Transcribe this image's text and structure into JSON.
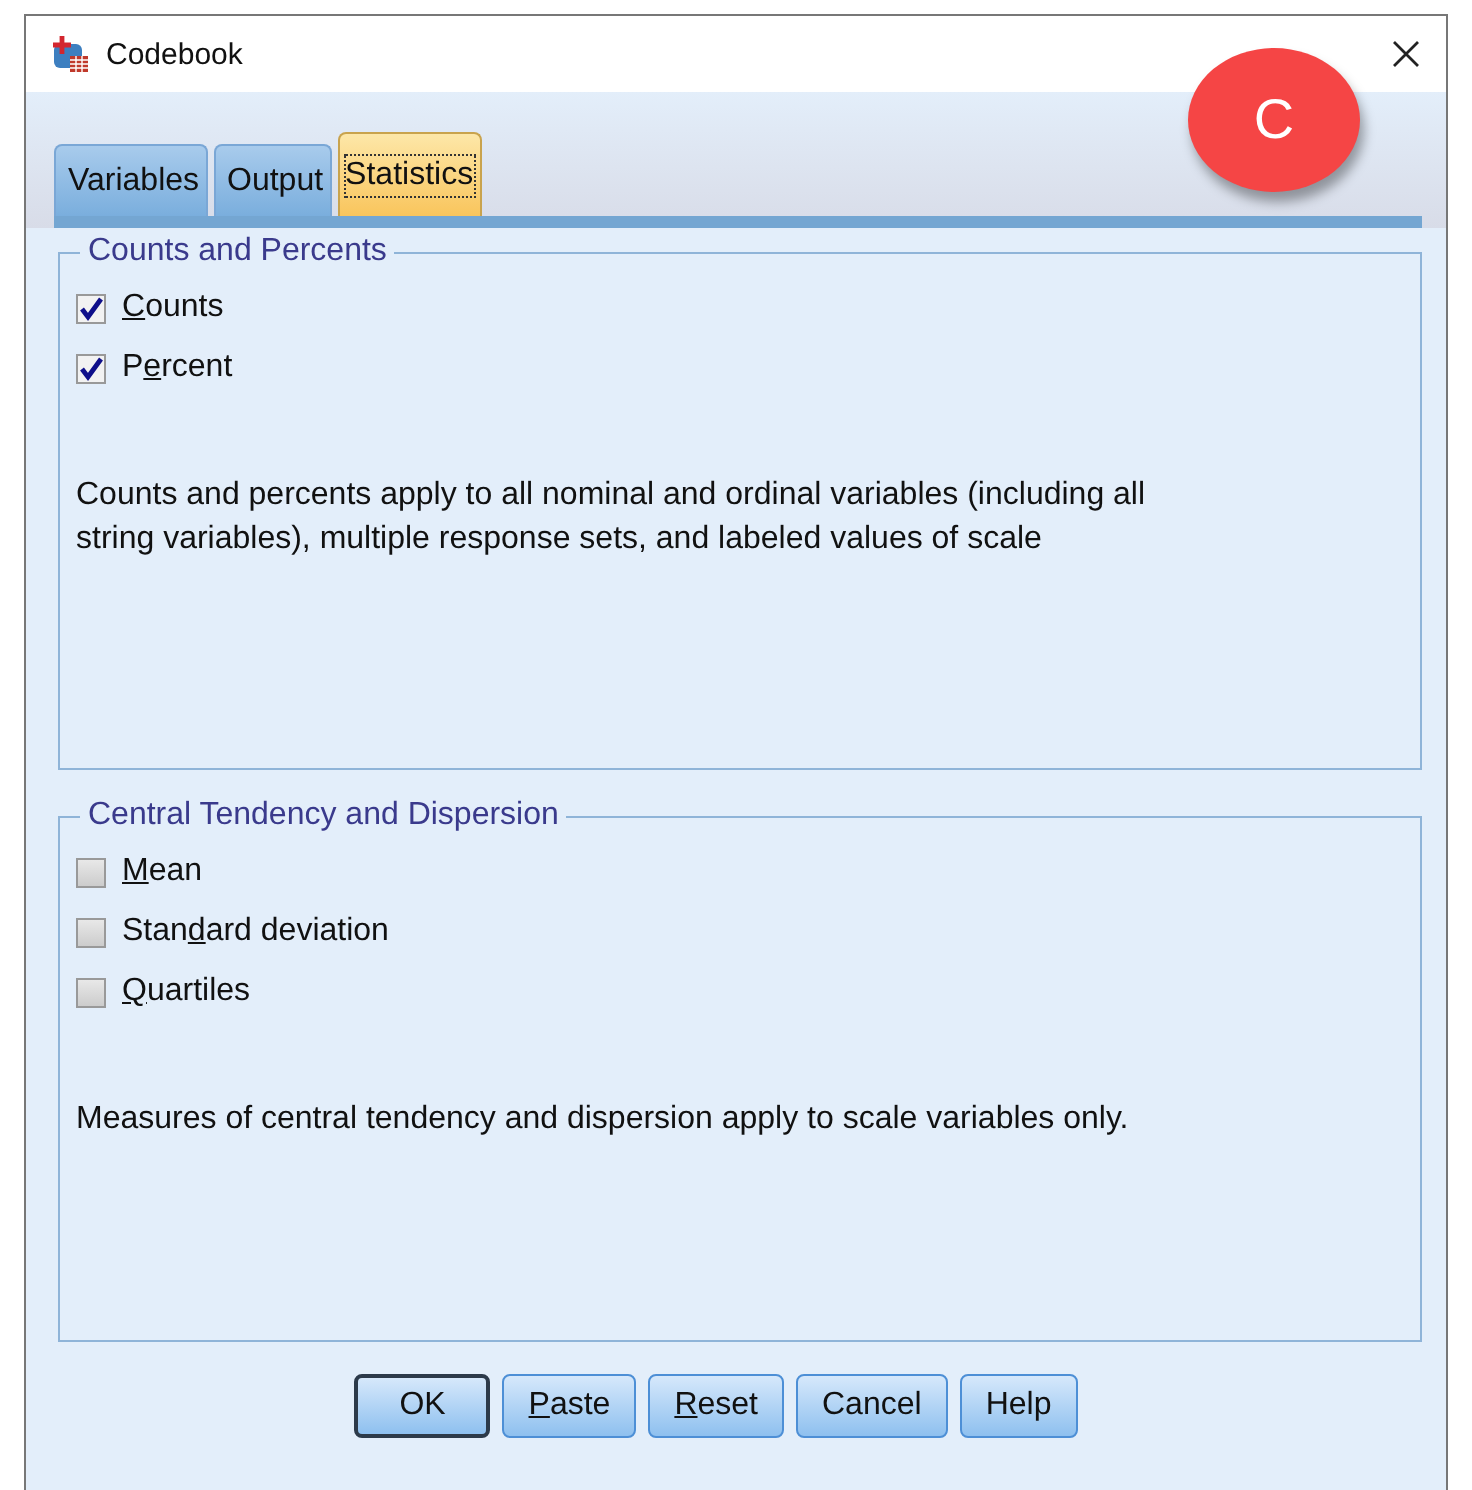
{
  "window": {
    "title": "Codebook"
  },
  "badge": {
    "label": "C"
  },
  "tabs": [
    {
      "label": "Variables",
      "selected": false
    },
    {
      "label": "Output",
      "selected": false
    },
    {
      "label": "Statistics",
      "selected": true
    }
  ],
  "groups": [
    {
      "title": "Counts and Percents",
      "options": [
        {
          "key": "C",
          "post": "ounts",
          "checked": true
        },
        {
          "pre": "P",
          "key": "e",
          "post": "rcent",
          "checked": true
        }
      ],
      "note": "Counts and percents apply to all nominal and ordinal variables (including all string variables), multiple response sets, and labeled values of scale"
    },
    {
      "title": "Central Tendency and Dispersion",
      "options": [
        {
          "key": "M",
          "post": "ean",
          "checked": false
        },
        {
          "pre": "Stan",
          "key": "d",
          "post": "ard deviation",
          "checked": false
        },
        {
          "key": "Q",
          "post": "uartiles",
          "checked": false
        }
      ],
      "note": "Measures of central tendency and dispersion apply to scale variables only."
    }
  ],
  "buttons": [
    {
      "post": "OK",
      "default": true
    },
    {
      "key": "P",
      "post": "aste",
      "default": false
    },
    {
      "key": "R",
      "post": "eset",
      "default": false
    },
    {
      "post": "Cancel",
      "default": false
    },
    {
      "post": "Help",
      "default": false
    }
  ]
}
